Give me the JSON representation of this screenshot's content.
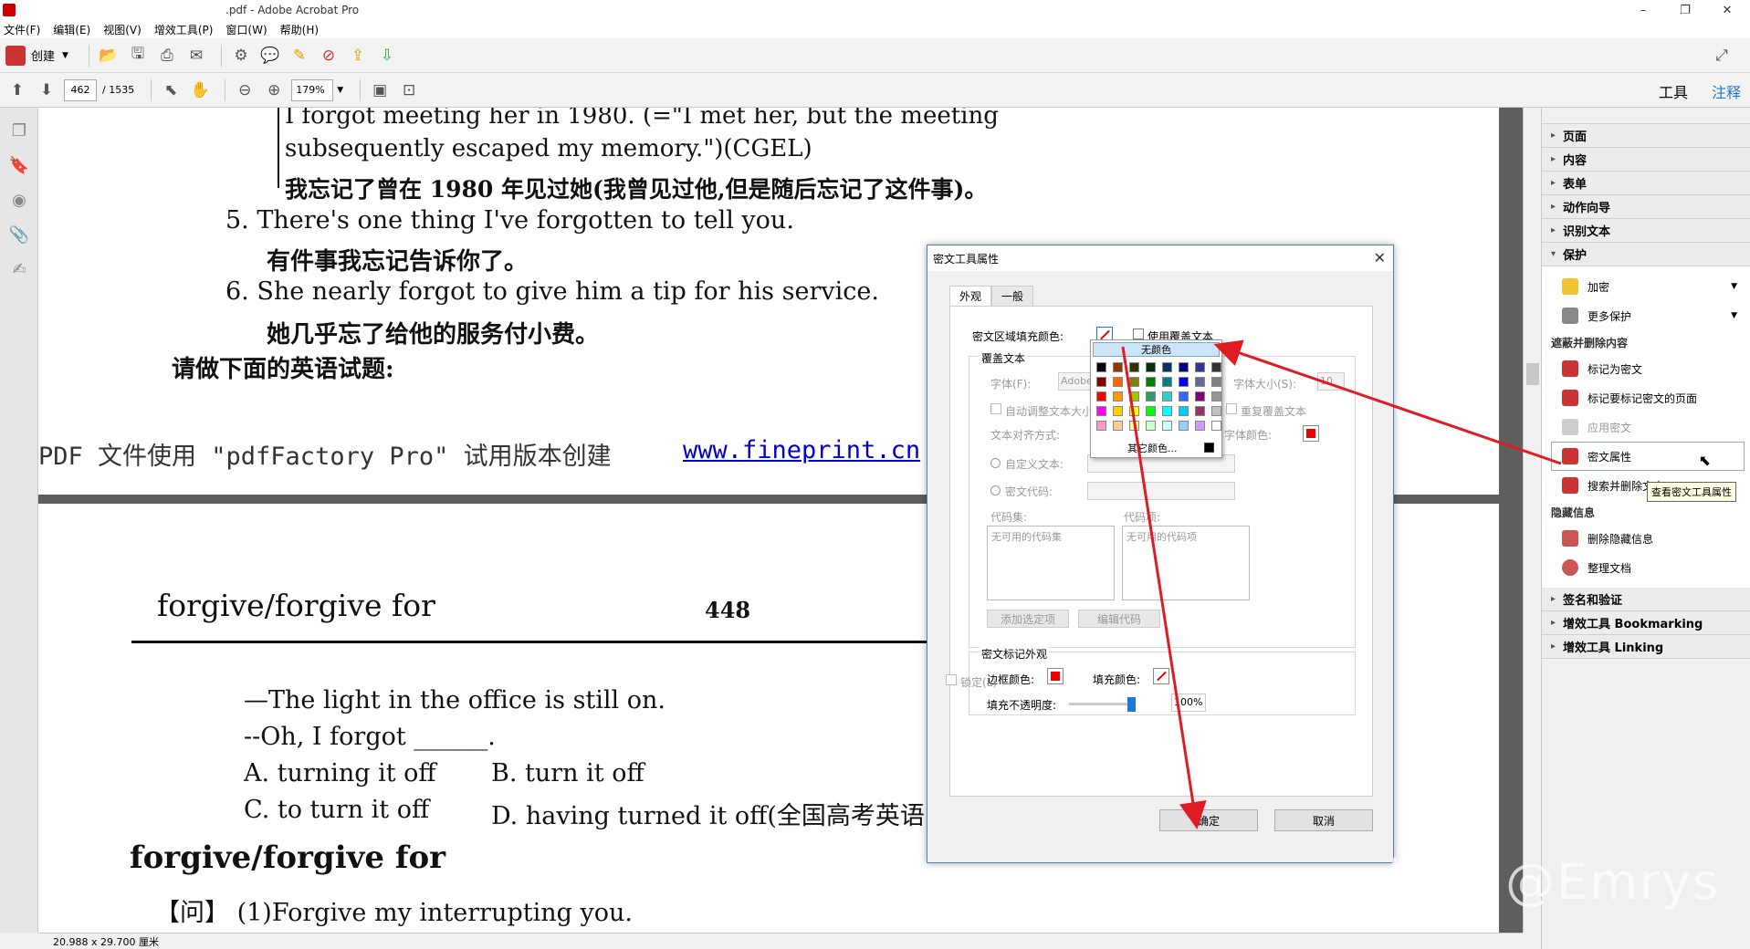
{
  "window": {
    "title": ".pdf - Adobe Acrobat Pro",
    "minimize": "–",
    "maximize": "❐",
    "close": "✕"
  },
  "menu": [
    "文件(F)",
    "编辑(E)",
    "视图(V)",
    "增效工具(P)",
    "窗口(W)",
    "帮助(H)"
  ],
  "toolbar": {
    "create_label": "创建",
    "page_current": "462",
    "page_total": "/ 1535",
    "zoom": "179%"
  },
  "right_tabs": {
    "tools": "工具",
    "comment": "注释"
  },
  "document": {
    "page1_lines": [
      "I forgot meeting her in 1980. (=\"I met her, but the meeting",
      "subsequently escaped my memory.\")(CGEL)",
      "我忘记了曾在 1980 年见过她(我曾见过他,但是随后忘记了这件事)。",
      "5. There's one thing I've forgotten to tell you.",
      "有件事我忘记告诉你了。",
      "6. She nearly forgot to give him a tip for his service.",
      "她几乎忘了给他的服务付小费。",
      "请做下面的英语试题:"
    ],
    "footer_text": "PDF 文件使用 \"pdfFactory Pro\" 试用版本创建",
    "footer_link": "www.fineprint.cn",
    "page2_header": "forgive/forgive for",
    "page2_number": "448",
    "page2_lines": [
      "—The light in the office is still on.",
      "--Oh, I forgot ______.",
      "A. turning it off",
      "B. turn it off",
      "C. to turn it off",
      "D. having turned it off(全国高考英语",
      "forgive/forgive for",
      "【问】 (1)Forgive my interrupting you."
    ]
  },
  "status_bar": {
    "size": "20.988 x 29.700 厘米"
  },
  "right_panel": {
    "sections_top": [
      "页面",
      "内容",
      "表单",
      "动作向导",
      "识别文本"
    ],
    "protect": "保护",
    "protect_items": [
      "加密",
      "更多保护"
    ],
    "redact_header": "遮蔽并删除内容",
    "redact_items": [
      "标记为密文",
      "标记要标记密文的页面",
      "应用密文",
      "密文属性",
      "搜索并删除文本"
    ],
    "hidden_header": "隐藏信息",
    "hidden_items": [
      "删除隐藏信息",
      "整理文档"
    ],
    "sections_bottom": [
      "签名和验证",
      "增效工具 Bookmarking",
      "增效工具 Linking"
    ],
    "tooltip": "查看密文工具属性"
  },
  "dialog": {
    "title": "密文工具属性",
    "tabs": [
      "外观",
      "一般"
    ],
    "fill_color_label": "密文区域填充颜色:",
    "use_overlay_label": "使用覆盖文本",
    "overlay_group": "覆盖文本",
    "font_label": "字体(F):",
    "font_value": "Adobe",
    "font_size_label": "字体大小(S):",
    "font_size_value": "10",
    "auto_size_label": "自动调整文本大小",
    "repeat_label": "重复覆盖文本",
    "align_label": "文本对齐方式:",
    "font_color_label": "字体颜色:",
    "custom_text_label": "自定义文本:",
    "redact_code_label": "密文代码:",
    "code_set_label": "代码集:",
    "code_item_label": "代码项:",
    "code_set_empty": "无可用的代码集",
    "code_item_empty": "无可用的代码项",
    "add_selected": "添加选定项",
    "edit_code": "编辑代码",
    "mark_group": "密文标记外观",
    "border_color_label": "边框颜色:",
    "fill_color2_label": "填充颜色:",
    "opacity_label": "填充不透明度:",
    "opacity_value": "100%",
    "lock_label": "锁定(L)",
    "ok": "确定",
    "cancel": "取消"
  },
  "color_popup": {
    "no_color": "无颜色",
    "other": "其它颜色...",
    "colors": [
      "#000000",
      "#993300",
      "#333300",
      "#003300",
      "#003366",
      "#000080",
      "#333399",
      "#333333",
      "#800000",
      "#ff6600",
      "#808000",
      "#008000",
      "#008080",
      "#0000ff",
      "#666699",
      "#808080",
      "#ff0000",
      "#ff9900",
      "#99cc00",
      "#339966",
      "#33cccc",
      "#3366ff",
      "#800080",
      "#969696",
      "#ff00ff",
      "#ffcc00",
      "#ffff00",
      "#00ff00",
      "#00ffff",
      "#00ccff",
      "#993366",
      "#c0c0c0",
      "#ff99cc",
      "#ffcc99",
      "#ffff99",
      "#ccffcc",
      "#ccffff",
      "#99ccff",
      "#cc99ff",
      "#ffffff"
    ]
  },
  "watermark": "知乎 @Emrys",
  "colors": {
    "annotation_arrow": "#e01b24",
    "accent_blue": "#1e78d7"
  }
}
